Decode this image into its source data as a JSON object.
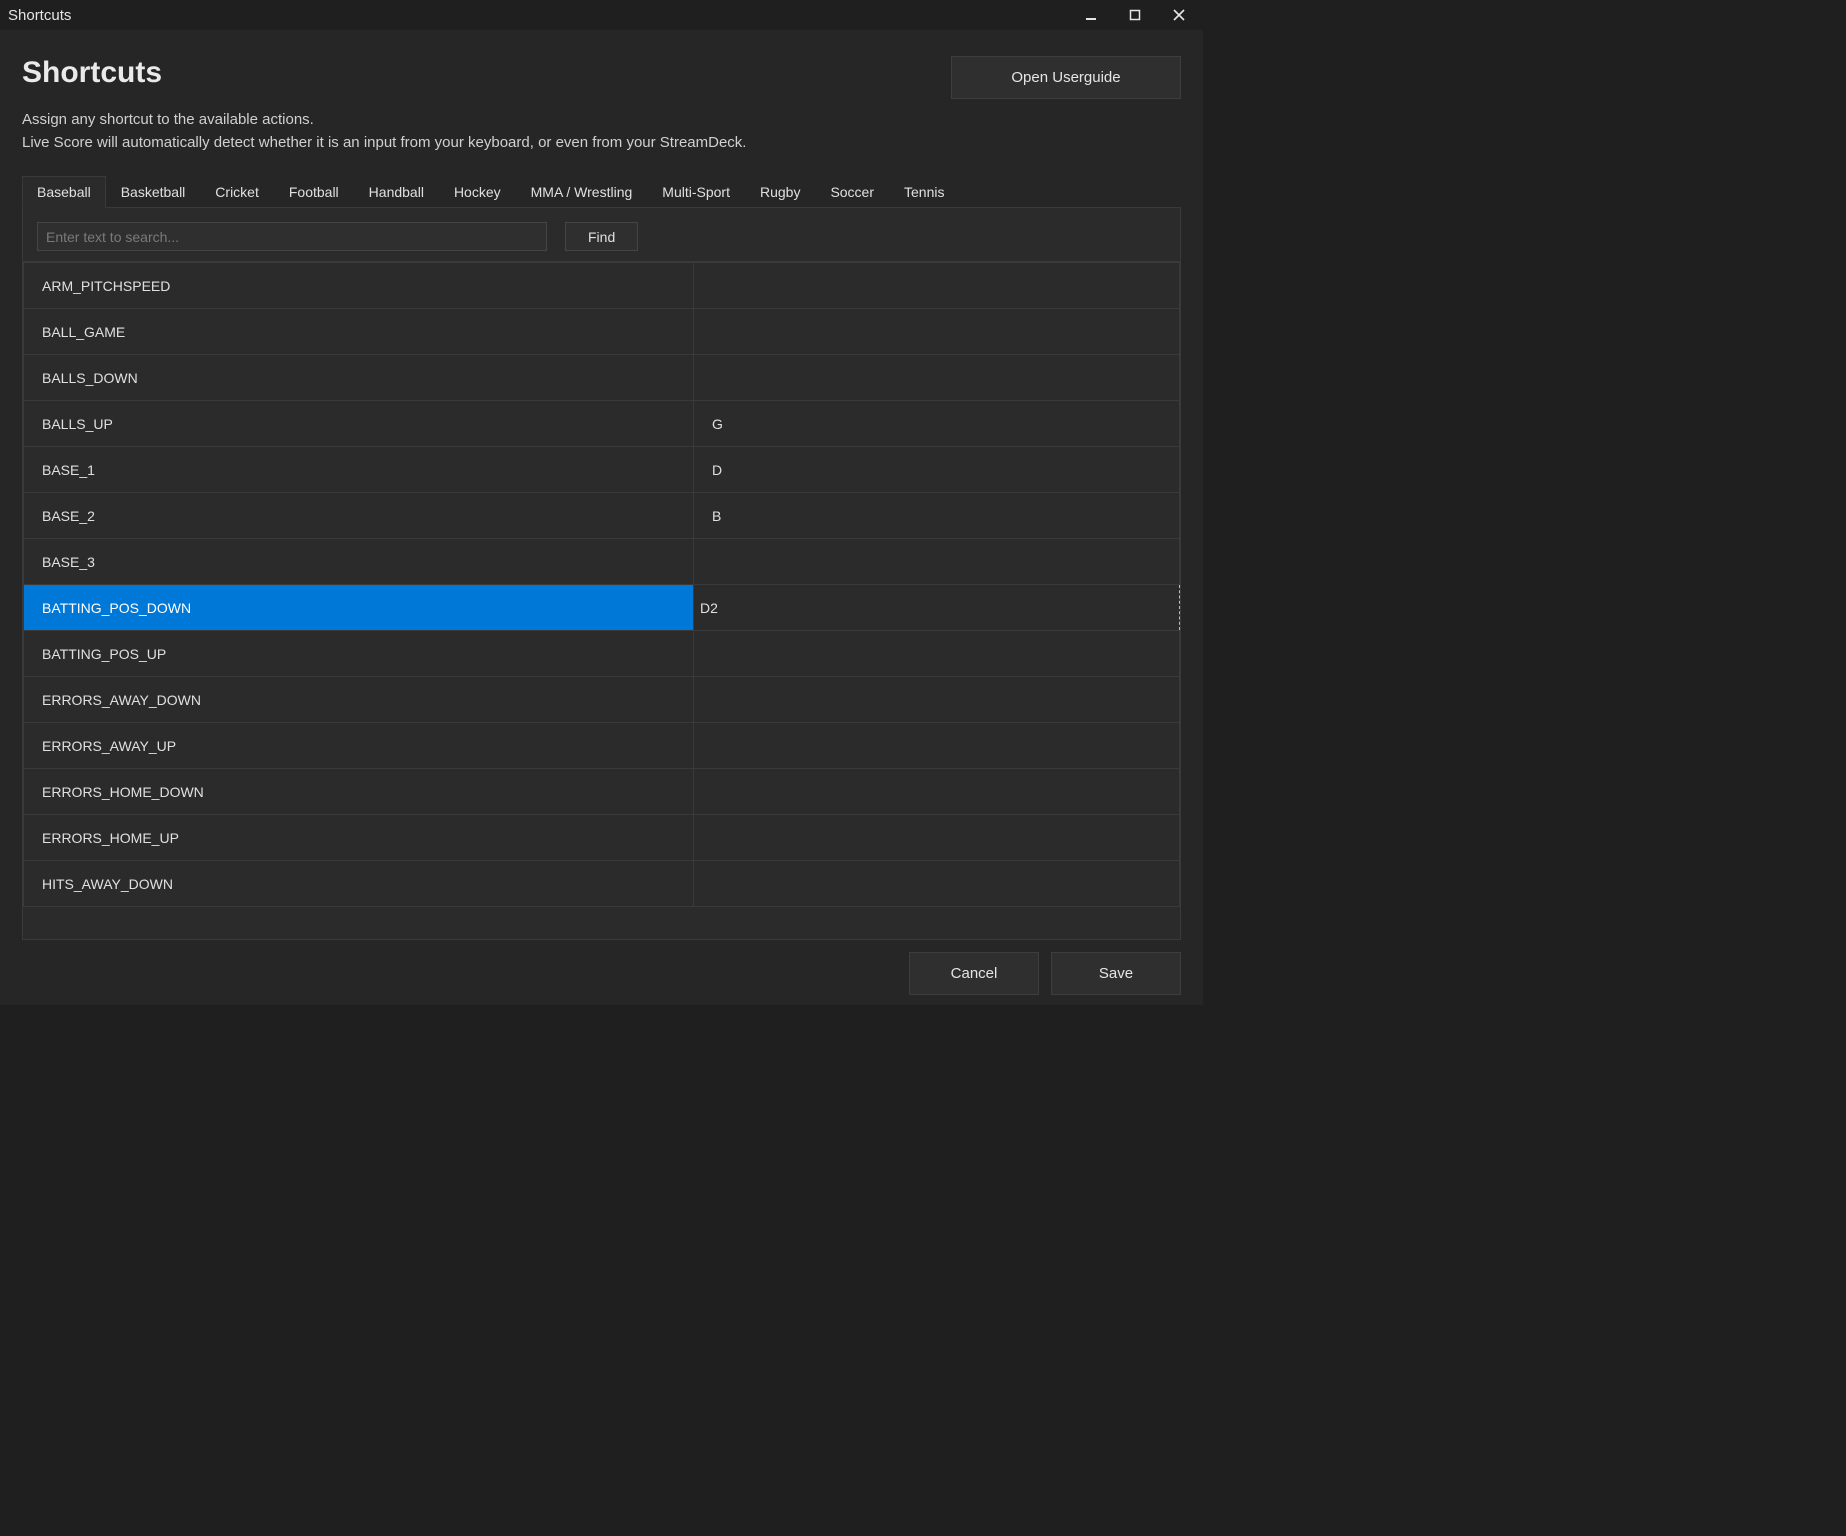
{
  "window": {
    "title": "Shortcuts"
  },
  "header": {
    "title": "Shortcuts",
    "userguide_label": "Open Userguide",
    "subtitle_line1": "Assign any shortcut to the available actions.",
    "subtitle_line2": "Live Score will automatically detect whether it is an input from your keyboard, or even from your StreamDeck."
  },
  "tabs": [
    {
      "label": "Baseball",
      "active": true
    },
    {
      "label": "Basketball"
    },
    {
      "label": "Cricket"
    },
    {
      "label": "Football"
    },
    {
      "label": "Handball"
    },
    {
      "label": "Hockey"
    },
    {
      "label": "MMA / Wrestling"
    },
    {
      "label": "Multi-Sport"
    },
    {
      "label": "Rugby"
    },
    {
      "label": "Soccer"
    },
    {
      "label": "Tennis"
    }
  ],
  "search": {
    "placeholder": "Enter text to search...",
    "value": "",
    "find_label": "Find"
  },
  "rows": [
    {
      "action": "ARM_PITCHSPEED",
      "key": ""
    },
    {
      "action": "BALL_GAME",
      "key": ""
    },
    {
      "action": "BALLS_DOWN",
      "key": ""
    },
    {
      "action": "BALLS_UP",
      "key": "G"
    },
    {
      "action": "BASE_1",
      "key": "D"
    },
    {
      "action": "BASE_2",
      "key": "B"
    },
    {
      "action": "BASE_3",
      "key": ""
    },
    {
      "action": "BATTING_POS_DOWN",
      "key": "D2",
      "selected": true
    },
    {
      "action": "BATTING_POS_UP",
      "key": ""
    },
    {
      "action": "ERRORS_AWAY_DOWN",
      "key": ""
    },
    {
      "action": "ERRORS_AWAY_UP",
      "key": ""
    },
    {
      "action": "ERRORS_HOME_DOWN",
      "key": ""
    },
    {
      "action": "ERRORS_HOME_UP",
      "key": ""
    },
    {
      "action": "HITS_AWAY_DOWN",
      "key": ""
    }
  ],
  "footer": {
    "cancel_label": "Cancel",
    "save_label": "Save"
  }
}
